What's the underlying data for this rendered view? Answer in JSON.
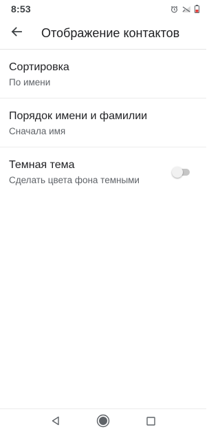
{
  "status_bar": {
    "time": "8:53",
    "icons": [
      "alarm-icon",
      "signal-off-icon",
      "battery-icon"
    ]
  },
  "app_bar": {
    "back_icon": "arrow-left-icon",
    "title": "Отображение контактов"
  },
  "settings": [
    {
      "title": "Сортировка",
      "subtitle": "По имени"
    },
    {
      "title": "Порядок имени и фамилии",
      "subtitle": "Сначала имя"
    },
    {
      "title": "Темная тема",
      "subtitle": "Сделать цвета фона темными",
      "toggle_on": false
    }
  ],
  "nav_bar": {
    "icons": [
      "back-triangle-icon",
      "home-circle-icon",
      "recents-square-icon"
    ]
  },
  "colors": {
    "background": "#ffffff",
    "primary_text": "#202124",
    "secondary_text": "#5f6368",
    "divider": "#ececec",
    "toggle_track_off": "#c6c6c6",
    "toggle_thumb_off": "#f1f1f1"
  }
}
